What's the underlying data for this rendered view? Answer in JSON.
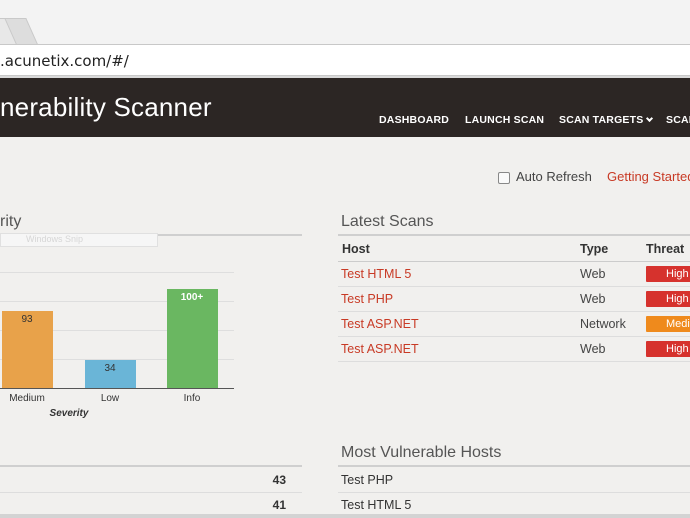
{
  "browser": {
    "url": ".acunetix.com/#/"
  },
  "header": {
    "title": "nerability Scanner",
    "nav": [
      {
        "label": "DASHBOARD"
      },
      {
        "label": "LAUNCH SCAN"
      },
      {
        "label": "SCAN TARGETS"
      },
      {
        "label": "SCAN"
      }
    ]
  },
  "toolbar": {
    "auto_refresh_label": "Auto Refresh",
    "auto_refresh_checked": false,
    "getting_started": "Getting Started"
  },
  "severity_panel": {
    "title": "rity",
    "ghost_text": "Windows Snip",
    "counts": [
      {
        "value": "43"
      },
      {
        "value": "41"
      }
    ]
  },
  "chart_data": {
    "type": "bar",
    "xlabel": "Severity",
    "categories": [
      "Medium",
      "Low",
      "Info"
    ],
    "values": [
      93,
      34,
      120
    ],
    "value_labels": [
      "93",
      "34",
      "100+"
    ],
    "colors": [
      "#e8a24a",
      "#6ab5d7",
      "#6ab761"
    ],
    "ylim": [
      0,
      140
    ],
    "grid": true
  },
  "latest_scans": {
    "title": "Latest Scans",
    "columns": [
      "Host",
      "Type",
      "Threat"
    ],
    "rows": [
      {
        "host": "Test HTML 5",
        "type": "Web",
        "threat": "High",
        "threat_color": "#d6322d"
      },
      {
        "host": "Test PHP",
        "type": "Web",
        "threat": "High",
        "threat_color": "#d6322d"
      },
      {
        "host": "Test ASP.NET",
        "type": "Network",
        "threat": "Medium",
        "threat_color": "#ef8a1c"
      },
      {
        "host": "Test ASP.NET",
        "type": "Web",
        "threat": "High",
        "threat_color": "#d6322d"
      }
    ]
  },
  "vulnerable_hosts": {
    "title": "Most Vulnerable Hosts",
    "rows": [
      {
        "host": "Test PHP"
      },
      {
        "host": "Test HTML 5"
      }
    ]
  }
}
